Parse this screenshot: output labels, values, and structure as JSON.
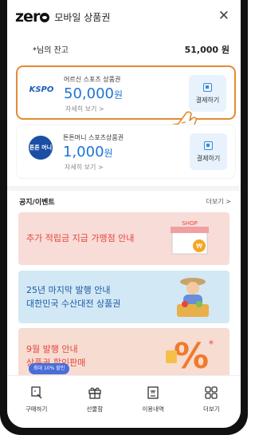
{
  "header": {
    "logo_text": "zero",
    "title": "모바일 상품권",
    "close_label": "✕"
  },
  "balance": {
    "label": "*님의 잔고",
    "amount": "51,000 원"
  },
  "cards": [
    {
      "logo_text": "KSPO",
      "name": "어르신 스포츠 상품권",
      "amount": "50,000",
      "unit": "원",
      "detail_label": "자세히 보기 >",
      "pay_label": "결제하기",
      "highlighted": true
    },
    {
      "logo_text": "튼튼 머니",
      "name": "튼튼머니 스포츠상품권",
      "amount": "1,000",
      "unit": "원",
      "detail_label": "자세히 보기 >",
      "pay_label": "결제하기",
      "highlighted": false
    }
  ],
  "notices": {
    "heading": "공지/이벤트",
    "more_label": "더보기 >",
    "banners": [
      {
        "text": "추가 적립금 지급 가맹점 안내",
        "badge": "SHOP"
      },
      {
        "line1": "25년 마지막 발행 안내",
        "line2": "대한민국 수산대전 상품권"
      },
      {
        "line1": "9월 발행 안내",
        "line2": "상품권 할인판매"
      }
    ]
  },
  "promo_badge": "최대 10% 할인",
  "tabbar": [
    {
      "label": "구매하기",
      "icon": "cart-icon"
    },
    {
      "label": "선물함",
      "icon": "gift-icon"
    },
    {
      "label": "이용내역",
      "icon": "receipt-icon"
    },
    {
      "label": "더보기",
      "icon": "grid-icon"
    }
  ],
  "colors": {
    "accent": "#1e74d6",
    "highlight_border": "#e58a34",
    "banner_red": "#e4473a",
    "banner_blue": "#1a5aa8"
  }
}
